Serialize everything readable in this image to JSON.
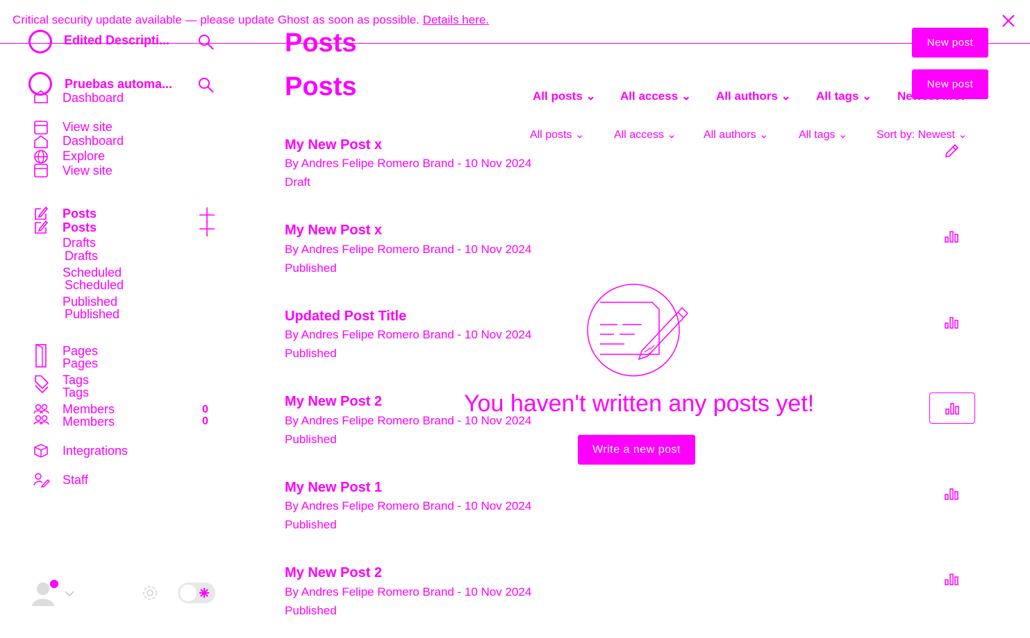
{
  "banner": {
    "message": "Critical security update available — please update Ghost as soon as possible.",
    "link_label": "Details here."
  },
  "site": {
    "name_primary": "Edited Descripti...",
    "name_secondary": "Pruebas automa..."
  },
  "nav": {
    "dashboard_1": "Dashboard",
    "view_site_1": "View site",
    "dashboard_2": "Dashboard",
    "explore": "Explore",
    "view_site_2": "View site",
    "posts_1": "Posts",
    "posts_2": "Posts",
    "drafts_1": "Drafts",
    "drafts_2": "Drafts",
    "scheduled_1": "Scheduled",
    "scheduled_2": "Scheduled",
    "published_1": "Published",
    "published_2": "Published",
    "pages_1": "Pages",
    "pages_2": "Pages",
    "tags_1": "Tags",
    "tags_2": "Tags",
    "members_1": "Members",
    "members_2": "Members",
    "members_count_1": "0",
    "members_count_2": "0",
    "integrations": "Integrations",
    "staff": "Staff"
  },
  "header": {
    "title_1": "Posts",
    "title_2": "Posts",
    "new_post_1": "New post",
    "new_post_2": "New post"
  },
  "filters_bold": {
    "posts": "All posts",
    "access": "All access",
    "authors": "All authors",
    "tags": "All tags",
    "sort": "Newest first"
  },
  "filters": {
    "posts": "All posts",
    "access": "All access",
    "authors": "All authors",
    "tags": "All tags",
    "sort": "Sort by: Newest"
  },
  "posts": [
    {
      "title": "My New Post x",
      "meta": "By Andres Felipe Romero Brand - 10 Nov 2024",
      "status": "Draft"
    },
    {
      "title": "My New Post x",
      "meta": "By Andres Felipe Romero Brand - 10 Nov 2024",
      "status": "Published"
    },
    {
      "title": "Updated Post Title",
      "meta": "By Andres Felipe Romero Brand - 10 Nov 2024",
      "status": "Published"
    },
    {
      "title": "My New Post 2",
      "meta": "By Andres Felipe Romero Brand - 10 Nov 2024",
      "status": "Published"
    },
    {
      "title": "My New Post 1",
      "meta": "By Andres Felipe Romero Brand - 10 Nov 2024",
      "status": "Published"
    },
    {
      "title": "My New Post 2",
      "meta": "By Andres Felipe Romero Brand - 10 Nov 2024",
      "status": "Published"
    }
  ],
  "empty_state": {
    "message": "You haven't written any posts yet!",
    "cta": "Write a new post"
  },
  "colors": {
    "accent": "#ff00ff",
    "background": "#ffffff"
  },
  "icons": [
    "close-icon",
    "search-icon",
    "dashboard-icon",
    "view-site-icon",
    "explore-icon",
    "posts-icon",
    "add-icon",
    "pages-icon",
    "tags-icon",
    "members-icon",
    "integrations-icon",
    "staff-icon",
    "edit-icon",
    "analytics-icon",
    "settings-icon",
    "theme-toggle",
    "avatar"
  ]
}
